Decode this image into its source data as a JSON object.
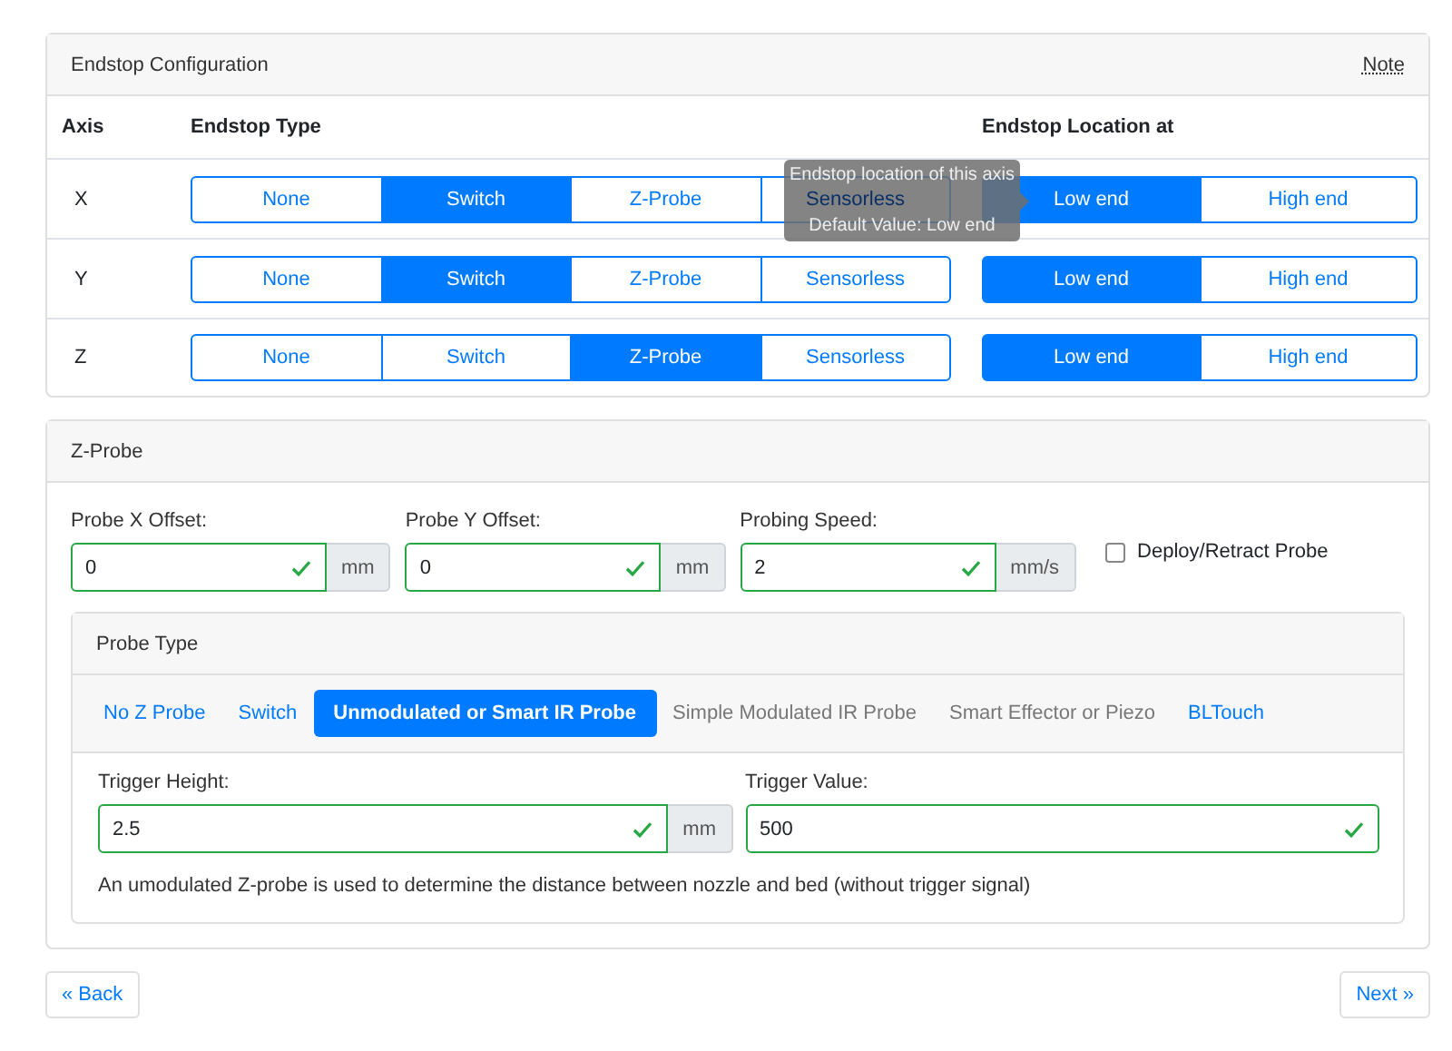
{
  "endstop_card": {
    "title": "Endstop Configuration",
    "note": "Note",
    "columns": [
      "Axis",
      "Endstop Type",
      "Endstop Location at"
    ],
    "rows": [
      {
        "axis": "X",
        "types": [
          {
            "label": "None",
            "selected": false
          },
          {
            "label": "Switch",
            "selected": true
          },
          {
            "label": "Z-Probe",
            "selected": false
          },
          {
            "label": "Sensorless",
            "selected": false
          }
        ],
        "locations": [
          {
            "label": "Low end",
            "selected": true
          },
          {
            "label": "High end",
            "selected": false
          }
        ],
        "tooltip": [
          "Endstop location of this axis",
          "Default Value: Low end"
        ]
      },
      {
        "axis": "Y",
        "types": [
          {
            "label": "None",
            "selected": false
          },
          {
            "label": "Switch",
            "selected": true
          },
          {
            "label": "Z-Probe",
            "selected": false
          },
          {
            "label": "Sensorless",
            "selected": false
          }
        ],
        "locations": [
          {
            "label": "Low end",
            "selected": true
          },
          {
            "label": "High end",
            "selected": false
          }
        ]
      },
      {
        "axis": "Z",
        "types": [
          {
            "label": "None",
            "selected": false
          },
          {
            "label": "Switch",
            "selected": false
          },
          {
            "label": "Z-Probe",
            "selected": true
          },
          {
            "label": "Sensorless",
            "selected": false
          }
        ],
        "locations": [
          {
            "label": "Low end",
            "selected": true
          },
          {
            "label": "High end",
            "selected": false
          }
        ]
      }
    ]
  },
  "zprobe_card": {
    "title": "Z-Probe",
    "fields": [
      {
        "label": "Probe X Offset:",
        "value": "0",
        "unit": "mm"
      },
      {
        "label": "Probe Y Offset:",
        "value": "0",
        "unit": "mm"
      },
      {
        "label": "Probing Speed:",
        "value": "2",
        "unit": "mm/s"
      }
    ],
    "deploy_checkbox": {
      "label": "Deploy/Retract Probe",
      "checked": false
    },
    "probe_type": {
      "title": "Probe Type",
      "tabs": [
        {
          "label": "No Z Probe",
          "selected": false,
          "disabled": false
        },
        {
          "label": "Switch",
          "selected": false,
          "disabled": false
        },
        {
          "label": "Unmodulated or Smart IR Probe",
          "selected": true,
          "disabled": false
        },
        {
          "label": "Simple Modulated IR Probe",
          "selected": false,
          "disabled": true
        },
        {
          "label": "Smart Effector or Piezo",
          "selected": false,
          "disabled": true
        },
        {
          "label": "BLTouch",
          "selected": false,
          "disabled": false
        }
      ],
      "fields": [
        {
          "label": "Trigger Height:",
          "value": "2.5",
          "unit": "mm"
        },
        {
          "label": "Trigger Value:",
          "value": "500"
        }
      ],
      "description": "An umodulated Z-probe is used to determine the distance between nozzle and bed (without trigger signal)"
    }
  },
  "nav": {
    "back": "« Back",
    "next": "Next »"
  }
}
